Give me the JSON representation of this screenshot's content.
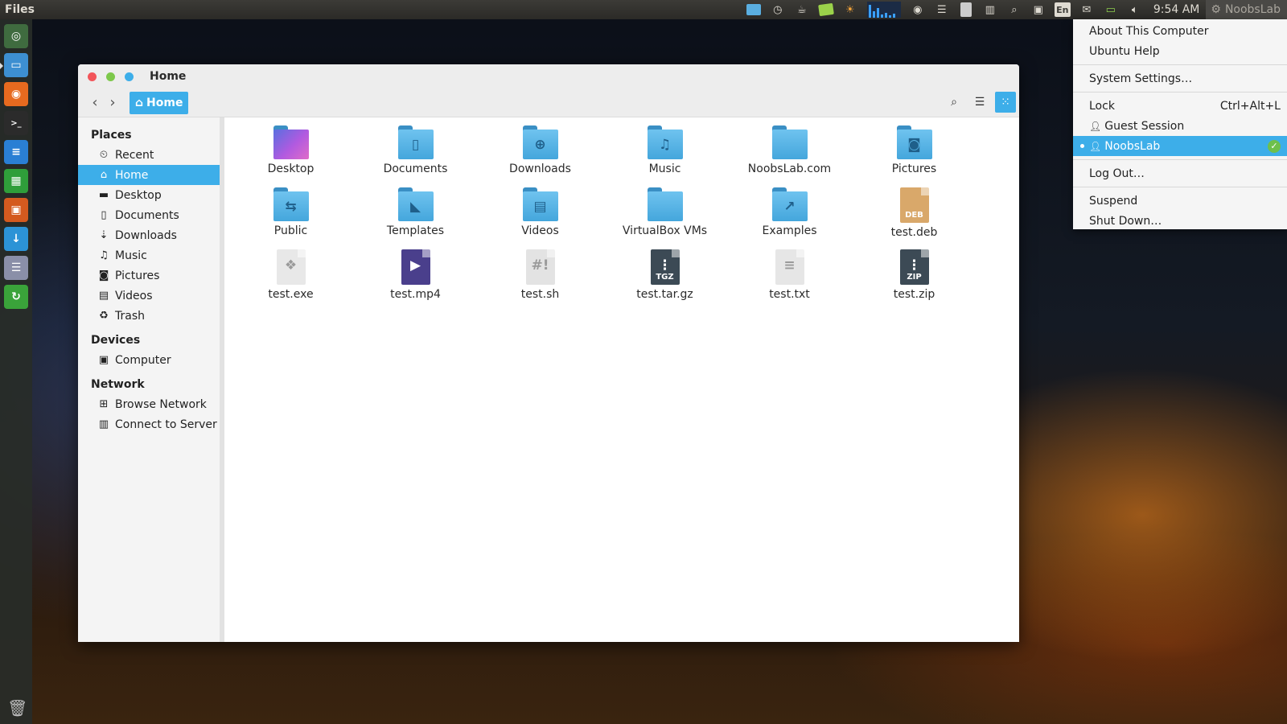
{
  "panel": {
    "app_name": "Files",
    "clock": "9:54 AM",
    "session_user": "NoobsLab",
    "keyboard_layout": "En"
  },
  "launcher": {
    "items": [
      {
        "name": "dash",
        "color": "#3f6b3f",
        "glyph": "◎"
      },
      {
        "name": "files",
        "color": "#3d8fd1",
        "glyph": "▭"
      },
      {
        "name": "firefox",
        "color": "#e76a1f",
        "glyph": "◉"
      },
      {
        "name": "terminal",
        "color": "#2b2b2b",
        "glyph": ">_"
      },
      {
        "name": "writer",
        "color": "#2a7fd4",
        "glyph": "≡"
      },
      {
        "name": "calc",
        "color": "#2f9e3a",
        "glyph": "▦"
      },
      {
        "name": "impress",
        "color": "#d45a1f",
        "glyph": "▣"
      },
      {
        "name": "download",
        "color": "#2c93d6",
        "glyph": "↓"
      },
      {
        "name": "settings",
        "color": "#8a8fa8",
        "glyph": "☰"
      },
      {
        "name": "update",
        "color": "#3aa33a",
        "glyph": "↻"
      }
    ]
  },
  "window": {
    "title": "Home",
    "breadcrumb": "Home",
    "close_color": "#f2555a",
    "minimize_color": "#7dc84b",
    "maximize_color": "#3daee9",
    "accent": "#3daee9"
  },
  "sidebar": {
    "places_header": "Places",
    "places": [
      {
        "label": "Recent",
        "icon": "⏲",
        "icon_name": "clock-icon"
      },
      {
        "label": "Home",
        "icon": "⌂",
        "icon_name": "home-icon",
        "selected": true
      },
      {
        "label": "Desktop",
        "icon": "▬",
        "icon_name": "folder-icon"
      },
      {
        "label": "Documents",
        "icon": "▯",
        "icon_name": "document-icon"
      },
      {
        "label": "Downloads",
        "icon": "⇣",
        "icon_name": "download-icon"
      },
      {
        "label": "Music",
        "icon": "♫",
        "icon_name": "music-icon"
      },
      {
        "label": "Pictures",
        "icon": "◙",
        "icon_name": "camera-icon"
      },
      {
        "label": "Videos",
        "icon": "▤",
        "icon_name": "film-icon"
      },
      {
        "label": "Trash",
        "icon": "♻",
        "icon_name": "trash-icon"
      }
    ],
    "devices_header": "Devices",
    "devices": [
      {
        "label": "Computer",
        "icon": "▣",
        "icon_name": "computer-icon"
      }
    ],
    "network_header": "Network",
    "network": [
      {
        "label": "Browse Network",
        "icon": "⊞",
        "icon_name": "network-icon"
      },
      {
        "label": "Connect to Server",
        "icon": "▥",
        "icon_name": "server-icon"
      }
    ]
  },
  "files": [
    {
      "label": "Desktop",
      "kind": "folder",
      "variant": "desk",
      "glyph": ""
    },
    {
      "label": "Documents",
      "kind": "folder",
      "glyph": "▯"
    },
    {
      "label": "Downloads",
      "kind": "folder",
      "glyph": "⊕"
    },
    {
      "label": "Music",
      "kind": "folder",
      "glyph": "♫"
    },
    {
      "label": "NoobsLab.com",
      "kind": "folder",
      "glyph": ""
    },
    {
      "label": "Pictures",
      "kind": "folder",
      "glyph": "◙"
    },
    {
      "label": "Public",
      "kind": "folder",
      "glyph": "⇆"
    },
    {
      "label": "Templates",
      "kind": "folder",
      "glyph": "◣"
    },
    {
      "label": "Videos",
      "kind": "folder",
      "glyph": "▤"
    },
    {
      "label": "VirtualBox VMs",
      "kind": "folder",
      "glyph": ""
    },
    {
      "label": "Examples",
      "kind": "folder",
      "glyph": "↗"
    },
    {
      "label": "test.deb",
      "kind": "doc",
      "bg": "#d9a86a",
      "glyph": "",
      "tag": "DEB"
    },
    {
      "label": "test.exe",
      "kind": "doc",
      "bg": "#e8e8e8",
      "glyph": "❖",
      "tag": ""
    },
    {
      "label": "test.mp4",
      "kind": "doc",
      "bg": "#4a3f8c",
      "glyph": "▶",
      "tag": ""
    },
    {
      "label": "test.sh",
      "kind": "doc",
      "bg": "#e3e3e3",
      "glyph": "#!",
      "tag": ""
    },
    {
      "label": "test.tar.gz",
      "kind": "doc",
      "bg": "#3c4a55",
      "glyph": "⋮",
      "tag": "TGZ"
    },
    {
      "label": "test.txt",
      "kind": "doc",
      "bg": "#e6e6e6",
      "glyph": "≡",
      "tag": ""
    },
    {
      "label": "test.zip",
      "kind": "doc",
      "bg": "#3c4a55",
      "glyph": "⋮",
      "tag": "ZIP"
    }
  ],
  "session_menu": {
    "about": "About This Computer",
    "help": "Ubuntu Help",
    "settings": "System Settings…",
    "lock": "Lock",
    "lock_accel": "Ctrl+Alt+L",
    "guest": "Guest Session",
    "user": "NoobsLab",
    "logout": "Log Out…",
    "suspend": "Suspend",
    "shutdown": "Shut Down…"
  }
}
